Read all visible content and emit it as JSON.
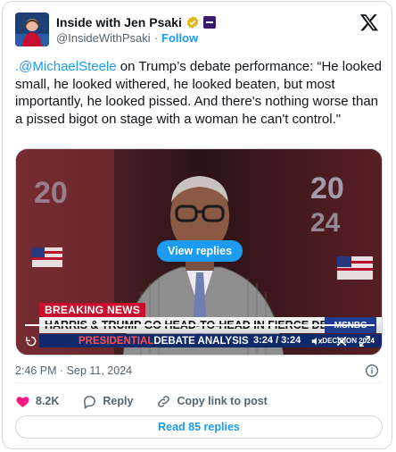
{
  "author": {
    "name": "Inside with Jen Psaki",
    "handle": "@InsideWithPsaki",
    "follow_label": "Follow",
    "verified_icon": "verified-gold-check-icon",
    "affiliate_icon": "affiliate-badge-icon"
  },
  "tweet": {
    "mention": ".@MichaelSteele",
    "text": " on Trump’s debate performance: “He looked small, he looked withered, he looked beaten, but most importantly, he looked pissed. And there's nothing worse than a pissed bigot on stage with a woman he can't control.\"",
    "timestamp": "2:46 PM · Sep 11, 2024"
  },
  "media": {
    "view_replies_label": "View replies",
    "breaking": "BREAKING NEWS",
    "headline": "HARRIS & TRUMP GO HEAD-TO-HEAD IN FIERCE DEBATE",
    "network": "MSNBC",
    "sub_a": "PRESIDENTIAL",
    "sub_b": "DEBATE ANALYSIS",
    "decision": "DECISION 2024",
    "time_readout": "3:24 / 3:24",
    "progress": 1.0
  },
  "actions": {
    "likes": "8.2K",
    "reply_label": "Reply",
    "copy_label": "Copy link to post",
    "read_replies_label": "Read 85 replies"
  },
  "colors": {
    "accent": "#1d9bf0",
    "like": "#f91880",
    "breaking": "#c8102e",
    "network_blue": "#1e3d8f"
  }
}
